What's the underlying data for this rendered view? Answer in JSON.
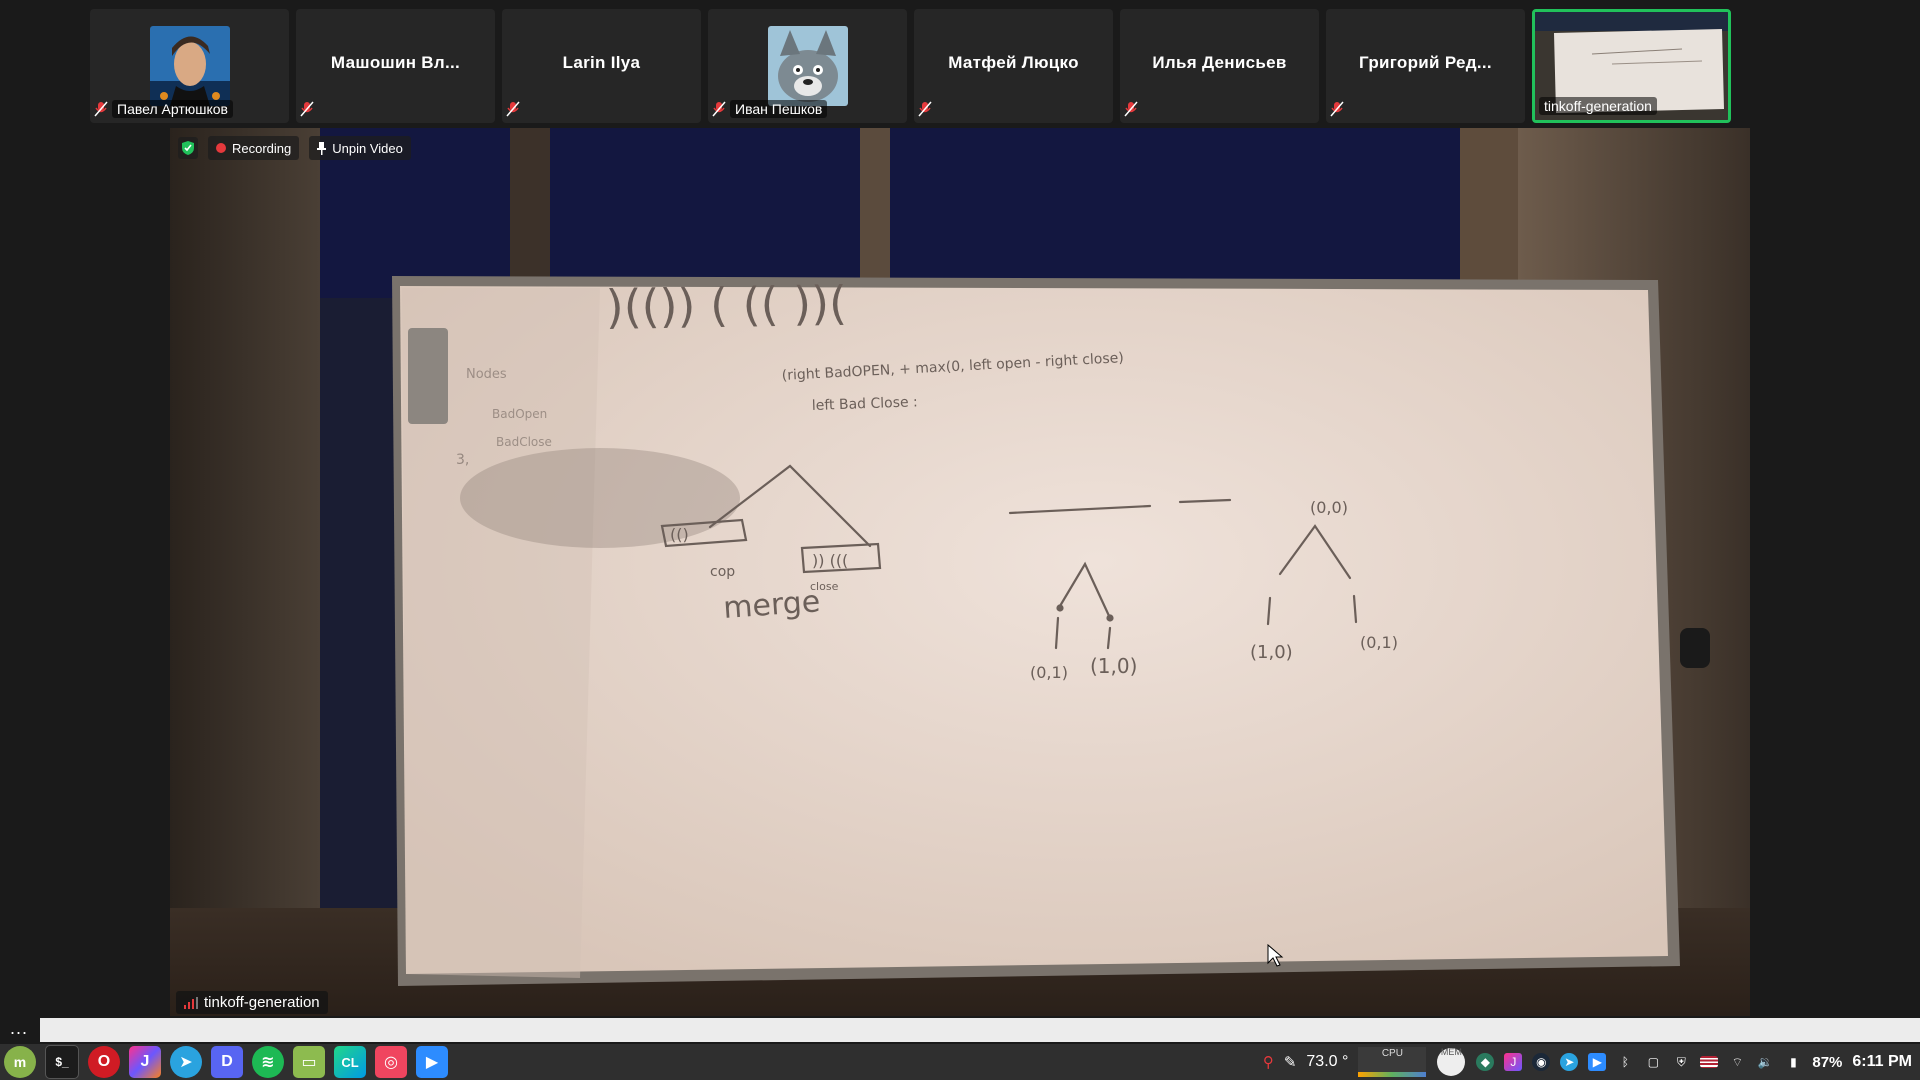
{
  "participants": [
    {
      "name": "Павел Артюшков",
      "display": "avatar-illustrated-man",
      "muted": true,
      "active": false
    },
    {
      "name": "Машошин Вл...",
      "display": "name",
      "muted": true,
      "active": false
    },
    {
      "name": "Larin Ilya",
      "display": "name",
      "muted": true,
      "active": false
    },
    {
      "name": "Иван Пешков",
      "display": "avatar-wolf",
      "muted": true,
      "active": false
    },
    {
      "name": "Матфей Люцко",
      "display": "name",
      "muted": true,
      "active": false
    },
    {
      "name": "Илья Денисьев",
      "display": "name",
      "muted": true,
      "active": false
    },
    {
      "name": "Григорий Ред...",
      "display": "name",
      "muted": true,
      "active": false
    },
    {
      "name": "tinkoff-generation",
      "display": "video-thumbnail",
      "muted": false,
      "active": true
    }
  ],
  "video_toolbar": {
    "recording_label": "Recording",
    "unpin_label": "Unpin Video"
  },
  "main_video": {
    "speaker_label": "tinkoff-generation",
    "whiteboard": {
      "bracket_sequence": ")(()) ( (( ))(",
      "legend_lines": [
        "Nodes",
        "BadOpen",
        "BadClose",
        "3,"
      ],
      "formula_line1": "(right BadOPEN, + max(0, left open - right close)",
      "formula_line2": "left Bad Close :",
      "tree_left_labels": [
        "(()",
        ")) (((",
        "cop",
        "close"
      ],
      "merge_word": "merge",
      "tree_mid_leaves": [
        "(0,1)",
        "(1,0)"
      ],
      "tree_right_root": "(0,0)",
      "tree_right_leaves": [
        "(1,0)",
        "(0,1)"
      ]
    }
  },
  "more_dots": "...",
  "taskbar": {
    "apps": [
      "menu",
      "terminal",
      "opera",
      "jetbrains-toolbox",
      "telegram",
      "discord",
      "spotify",
      "files",
      "clion",
      "gitkraken",
      "zoom"
    ],
    "temperature": "73.0 °",
    "cpu_label": "CPU",
    "mem_label": "MEM",
    "battery": "87%",
    "clock": "6:11 PM"
  },
  "colors": {
    "active_border": "#21c15b",
    "recording": "#e5393c",
    "taskbar_bg": "#2f2f2f",
    "muted_icon": "#e5393c"
  }
}
